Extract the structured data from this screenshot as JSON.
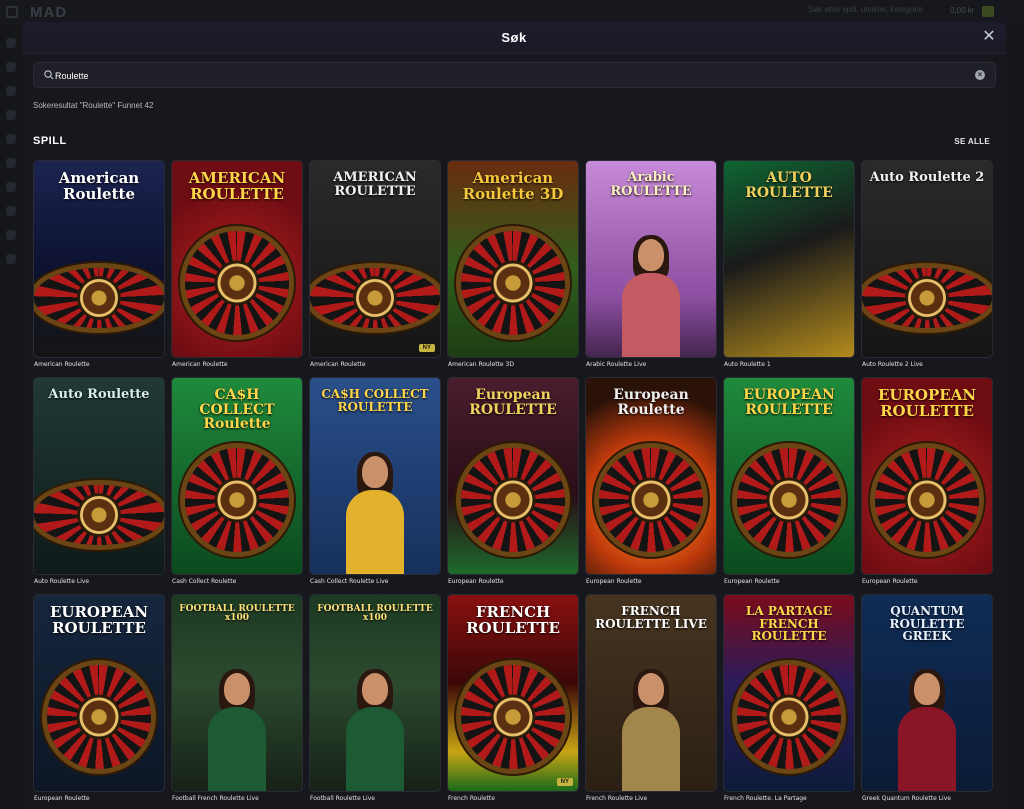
{
  "background": {
    "logo": "MAD",
    "search_placeholder": "Søk etter spill, utvikler, kategorie",
    "balance": "0,00 kr"
  },
  "modal": {
    "title": "Søk",
    "search_value": "Roulette",
    "result_text": "Sokeresultat \"Roulette\" Funnet 42",
    "section_title": "SPILL",
    "see_all": "SE ALLE"
  },
  "games": [
    {
      "label": "American Roulette",
      "art": "American Roulette",
      "theme": "blue",
      "badge": ""
    },
    {
      "label": "American Roulette",
      "art": "AMERICAN ROULETTE",
      "theme": "red",
      "badge": ""
    },
    {
      "label": "American Roulette",
      "art": "AMERICAN ROULETTE",
      "theme": "dark",
      "badge": "NY"
    },
    {
      "label": "American Roulette 3D",
      "art": "American Roulette 3D",
      "theme": "green",
      "badge": ""
    },
    {
      "label": "Arabic Roulette Live",
      "art": "Arabic ROULETTE",
      "theme": "purple",
      "badge": ""
    },
    {
      "label": "Auto Roulette 1",
      "art": "AUTO ROULETTE",
      "theme": "auto",
      "badge": ""
    },
    {
      "label": "Auto Roulette 2 Live",
      "art": "Auto Roulette 2",
      "theme": "dark",
      "badge": ""
    },
    {
      "label": "Auto Roulette Live",
      "art": "Auto Roulette",
      "theme": "teal",
      "badge": ""
    },
    {
      "label": "Cash Collect Roulette",
      "art": "CA$H COLLECT Roulette",
      "theme": "emerald",
      "badge": ""
    },
    {
      "label": "Cash Collect Roulette Live",
      "art": "CA$H COLLECT ROULETTE",
      "theme": "studio",
      "badge": ""
    },
    {
      "label": "European Roulette",
      "art": "European ROULETTE",
      "theme": "maroon",
      "badge": ""
    },
    {
      "label": "European Roulette",
      "art": "European Roulette",
      "theme": "fire",
      "badge": ""
    },
    {
      "label": "European Roulette",
      "art": "EUROPEAN ROULETTE",
      "theme": "emerald",
      "badge": ""
    },
    {
      "label": "European Roulette",
      "art": "EUROPEAN ROULETTE",
      "theme": "red",
      "badge": ""
    },
    {
      "label": "European Roulette",
      "art": "EUROPEAN ROULETTE",
      "theme": "navy",
      "badge": ""
    },
    {
      "label": "Football French Roulette Live",
      "art": "FOOTBALL ROULETTE x100",
      "theme": "stadium",
      "badge": ""
    },
    {
      "label": "Football Roulette Live",
      "art": "FOOTBALL ROULETTE x100",
      "theme": "stadium",
      "badge": ""
    },
    {
      "label": "French Roulette",
      "art": "FRENCH ROULETTE",
      "theme": "french",
      "badge": "NY"
    },
    {
      "label": "French Roulette Live",
      "art": "FRENCH ROULETTE LIVE",
      "theme": "gold",
      "badge": ""
    },
    {
      "label": "French Roulette. La Partage",
      "art": "LA PARTAGE FRENCH ROULETTE",
      "theme": "neon",
      "badge": ""
    },
    {
      "label": "Greek Quantum Roulette Live",
      "art": "QUANTUM ROULETTE GREEK",
      "theme": "quantum",
      "badge": ""
    }
  ]
}
